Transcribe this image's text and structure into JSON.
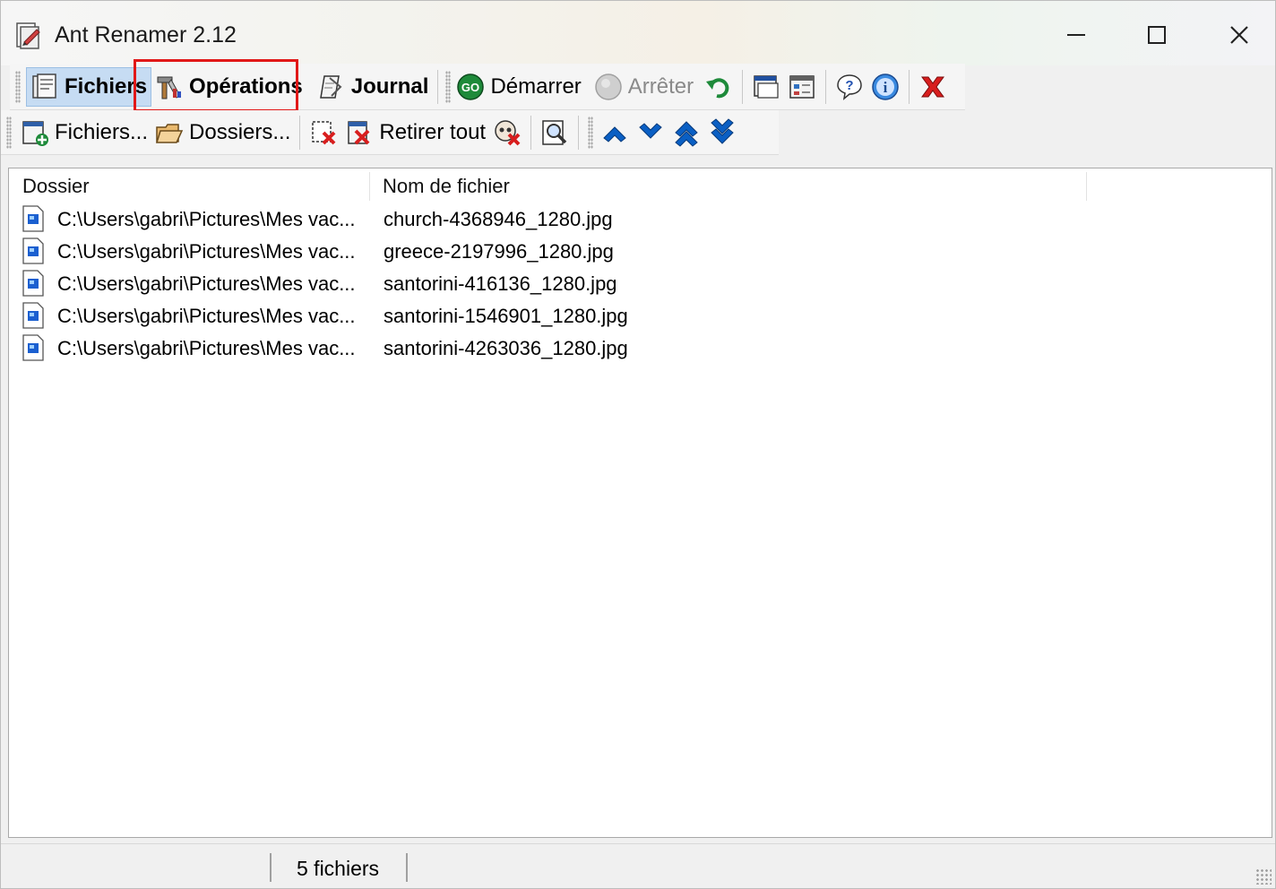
{
  "window": {
    "title": "Ant Renamer 2.12",
    "icons": {
      "app": "app-renamer-icon",
      "minimize": "minimize-icon",
      "maximize": "maximize-icon",
      "close": "close-icon"
    }
  },
  "toolbar_main": {
    "files_tab": {
      "label": "Fichiers",
      "icon": "files-icon",
      "active": true
    },
    "operations_tab": {
      "label": "Opérations",
      "icon": "operations-tools-icon",
      "highlighted": true
    },
    "journal_tab": {
      "label": "Journal",
      "icon": "journal-icon"
    },
    "start": {
      "label": "Démarrer",
      "icon": "go-icon"
    },
    "stop": {
      "label": "Arrêter",
      "icon": "stop-icon",
      "disabled": true
    },
    "icon_buttons": [
      "undo-icon",
      "window-icon",
      "preview-icon",
      "help-icon",
      "info-icon",
      "exit-icon"
    ]
  },
  "toolbar_files": {
    "add_files": {
      "label": "Fichiers...",
      "icon": "add-files-icon"
    },
    "add_folders": {
      "label": "Dossiers...",
      "icon": "folder-icon"
    },
    "remove_selected": {
      "icon": "remove-selected-icon"
    },
    "remove_all": {
      "label": "Retirer tout",
      "icon": "remove-all-icon"
    },
    "remove_dead": {
      "icon": "remove-dead-icon"
    },
    "find": {
      "icon": "search-icon"
    },
    "move_buttons": [
      "move-up-icon",
      "move-down-icon",
      "move-top-icon",
      "move-bottom-icon"
    ]
  },
  "file_list": {
    "columns": [
      "Dossier",
      "Nom de fichier"
    ],
    "rows": [
      {
        "folder": "C:\\Users\\gabri\\Pictures\\Mes vac...",
        "name": "church-4368946_1280.jpg"
      },
      {
        "folder": "C:\\Users\\gabri\\Pictures\\Mes vac...",
        "name": "greece-2197996_1280.jpg"
      },
      {
        "folder": "C:\\Users\\gabri\\Pictures\\Mes vac...",
        "name": "santorini-416136_1280.jpg"
      },
      {
        "folder": "C:\\Users\\gabri\\Pictures\\Mes vac...",
        "name": "santorini-1546901_1280.jpg"
      },
      {
        "folder": "C:\\Users\\gabri\\Pictures\\Mes vac...",
        "name": "santorini-4263036_1280.jpg"
      }
    ],
    "row_icon": "image-file-icon"
  },
  "statusbar": {
    "count": "5 fichiers"
  },
  "colors": {
    "highlight": "#e11818",
    "active_tab": "#c6dcf3",
    "arrow_blue": "#0a5fc4"
  }
}
